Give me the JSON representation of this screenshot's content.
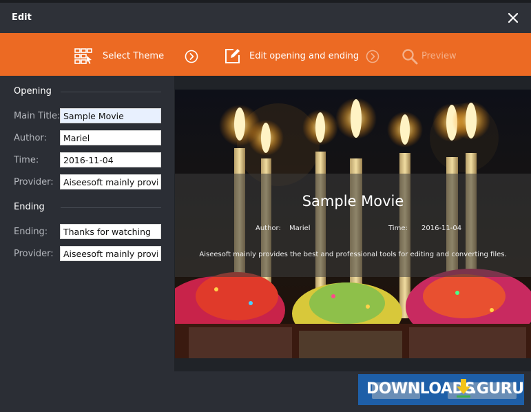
{
  "window": {
    "title": "Edit"
  },
  "steps": [
    {
      "label": "Select Theme",
      "icon": "select-theme-icon",
      "state": "done"
    },
    {
      "label": "Edit opening and ending",
      "icon": "edit-icon",
      "state": "active"
    },
    {
      "label": "Preview",
      "icon": "search-icon",
      "state": "disabled"
    }
  ],
  "opening": {
    "heading": "Opening",
    "main_title_label": "Main Title:",
    "main_title_value": "Sample Movie",
    "author_label": "Author:",
    "author_value": "Mariel",
    "time_label": "Time:",
    "time_value": "2016-11-04",
    "provider_label": "Provider:",
    "provider_value": "Aiseesoft mainly provides"
  },
  "ending": {
    "heading": "Ending",
    "ending_label": "Ending:",
    "ending_value": "Thanks for watching",
    "provider_label": "Provider:",
    "provider_value": "Aiseesoft mainly provides"
  },
  "preview": {
    "title": "Sample Movie",
    "author_label": "Author:",
    "author_value": "Mariel",
    "time_label": "Time:",
    "time_value": "2016-11-04",
    "description": "Aiseesoft mainly provides the best and professional tools for editing and converting files."
  },
  "watermark": {
    "text_left": "DOWNLOADS",
    "text_right": ".GURU"
  },
  "colors": {
    "accent": "#ec6a23",
    "background": "#2b2e35",
    "watermark": "#1e5fa8"
  }
}
